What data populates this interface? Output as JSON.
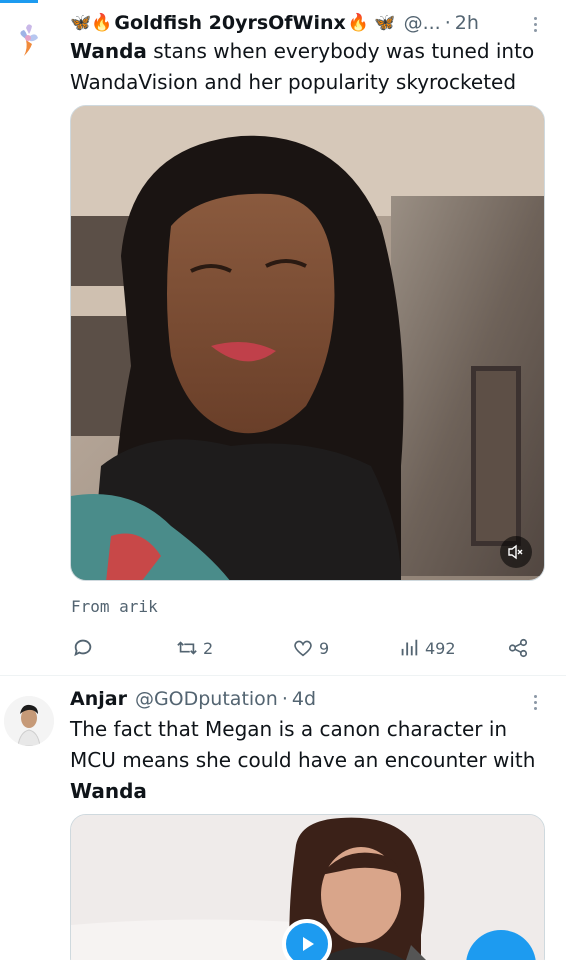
{
  "tweet1": {
    "emoji_left": "🦋🔥",
    "display_name": "Goldfish 20yrsOfWinx",
    "emoji_right": "🔥 🦋",
    "handle": "@...",
    "dot": "·",
    "time": "2h",
    "text_bold": "Wanda",
    "text_rest": " stans when everybody was tuned into WandaVision and her popularity skyrocketed",
    "from_label": "From arik",
    "mute_icon": "volume-mute-icon",
    "stats": {
      "replies": "",
      "retweets": "2",
      "likes": "9",
      "views": "492"
    }
  },
  "tweet2": {
    "display_name": "Anjar",
    "handle": "@GODputation",
    "dot": "·",
    "time": "4d",
    "text_rest": "The fact that Megan is a canon character in MCU means she could have an encounter with ",
    "text_bold": "Wanda"
  },
  "colors": {
    "accent": "#1d9bf0",
    "secondary_text": "#536471"
  }
}
